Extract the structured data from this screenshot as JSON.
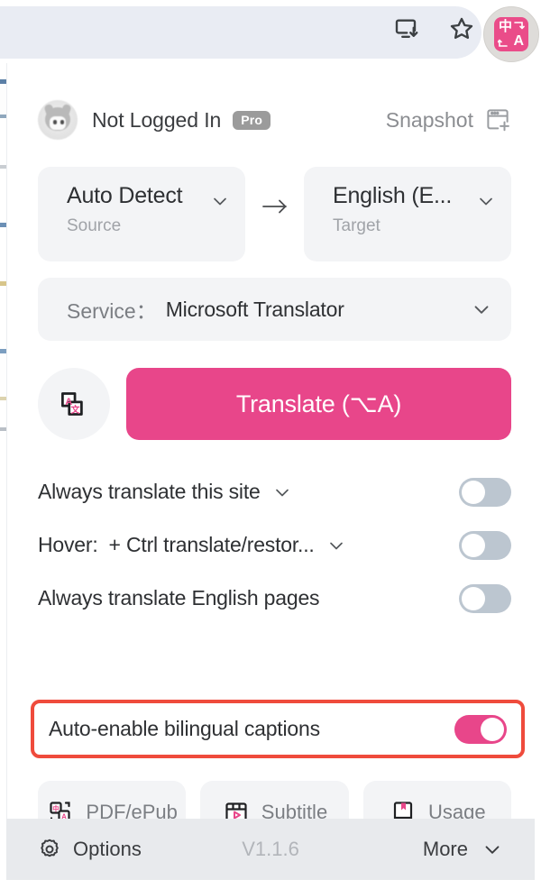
{
  "browser": {
    "install_icon": "install-app-icon",
    "bookmark_icon": "bookmark-star-icon",
    "extension_icon": "immersive-translate-extension-icon",
    "extension_glyph_primary": "中",
    "extension_glyph_secondary": "A"
  },
  "header": {
    "account_name": "Not Logged In",
    "pro_badge": "Pro",
    "snapshot_label": "Snapshot",
    "snapshot_icon": "snapshot-window-plus-icon",
    "avatar_icon": "user-avatar"
  },
  "language": {
    "source_value": "Auto Detect",
    "source_label": "Source",
    "target_value": "English (E...",
    "target_label": "Target",
    "arrow_icon": "arrow-right-icon",
    "chevron_icon": "chevron-down-icon"
  },
  "service": {
    "label": "Service：",
    "value": "Microsoft Translator",
    "chevron_icon": "chevron-down-icon"
  },
  "translate": {
    "swap_icon": "translate-cards-icon",
    "button_label": "Translate (⌥A)",
    "accent_color": "#e8468a"
  },
  "toggles": [
    {
      "label": "Always translate this site",
      "has_chevron": true,
      "secondary_label": "",
      "state": "off"
    },
    {
      "label": "Hover:",
      "secondary_label": "+ Ctrl translate/restor...",
      "has_chevron": true,
      "state": "off"
    },
    {
      "label": "Always translate English pages",
      "has_chevron": false,
      "secondary_label": "",
      "state": "off"
    }
  ],
  "highlighted_toggle": {
    "label": "Auto-enable bilingual captions",
    "state": "on",
    "highlight_color": "#ef4b3c"
  },
  "actions": [
    {
      "label": "PDF/ePub",
      "icon": "pdf-epub-icon"
    },
    {
      "label": "Subtitle",
      "icon": "subtitle-video-icon"
    },
    {
      "label": "Usage",
      "icon": "usage-book-icon"
    }
  ],
  "footer": {
    "options_label": "Options",
    "options_icon": "gear-icon",
    "version": "V1.1.6",
    "more_label": "More",
    "more_icon": "chevron-down-icon"
  }
}
